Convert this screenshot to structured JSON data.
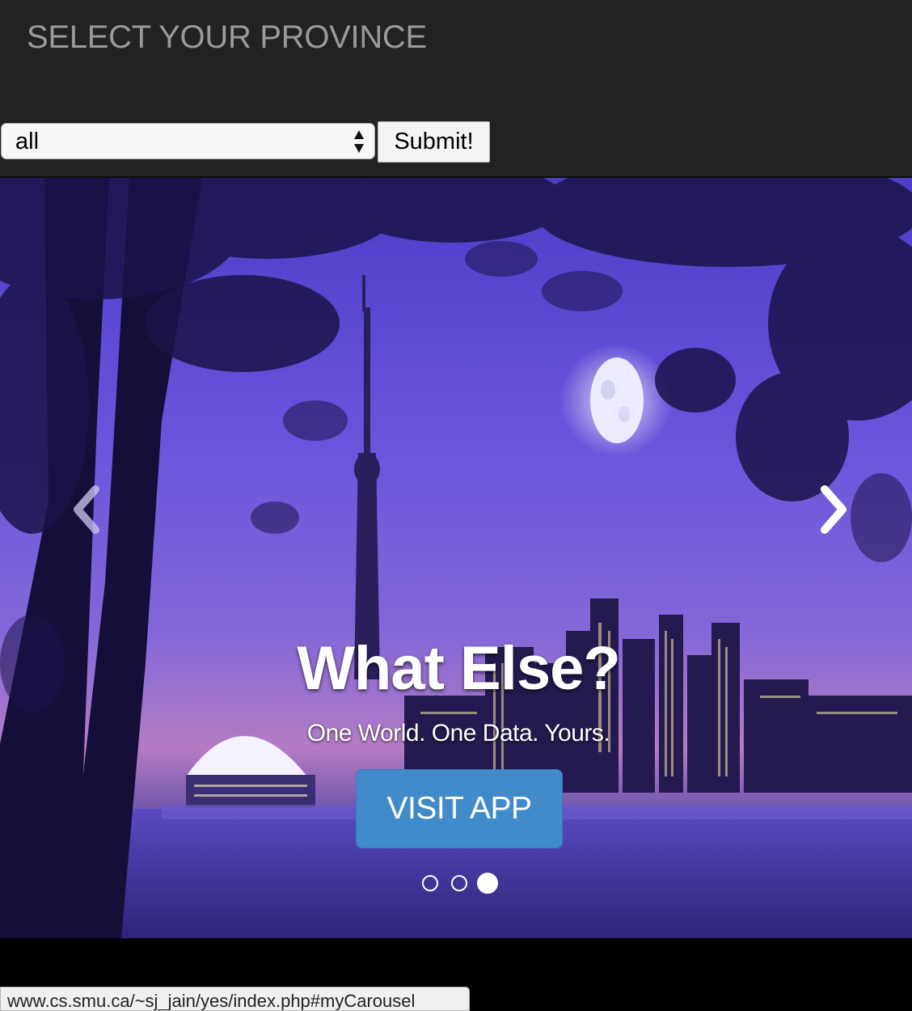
{
  "header": {
    "title": "SELECT YOUR PROVINCE",
    "province_select": {
      "selected": "all"
    },
    "submit_label": "Submit!"
  },
  "carousel": {
    "background_image": "night city skyline with tower, moon and trees",
    "caption_title": "What Else?",
    "caption_text": "One World. One Data. Yours.",
    "button_label": "VISIT APP",
    "indicators": {
      "count": 3,
      "active_index": 2
    },
    "prev_icon": "chevron-left-icon",
    "next_icon": "chevron-right-icon"
  },
  "status_bar": {
    "url": "www.cs.smu.ca/~sj_jain/yes/index.php#myCarousel"
  },
  "colors": {
    "header_bg": "#222222",
    "title_color": "#9a9a9a",
    "button_primary": "#428bca",
    "sky_purple": "#6c52d8"
  }
}
